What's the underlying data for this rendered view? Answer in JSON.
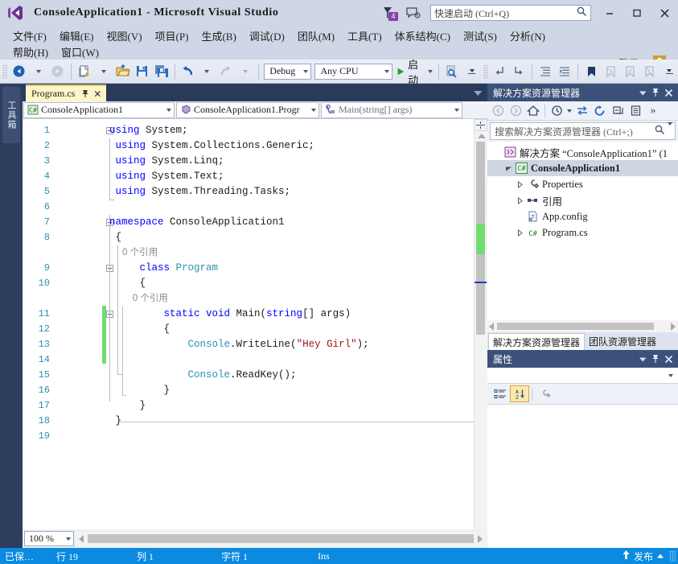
{
  "window": {
    "title": "ConsoleApplication1 - Microsoft Visual Studio",
    "logo_icon": "visual-studio-logo",
    "notifications": {
      "icon": "notification-flag-icon",
      "count": "4"
    },
    "feedback_icon": "feedback-icon",
    "quick_launch": {
      "placeholder": "快速启动 (Ctrl+Q)",
      "value": "",
      "icon": "search-icon"
    },
    "controls": {
      "minimize": "minimize-icon",
      "maximize": "maximize-icon",
      "close": "close-icon"
    }
  },
  "menu": {
    "row1": [
      "文件(F)",
      "编辑(E)",
      "视图(V)",
      "项目(P)",
      "生成(B)",
      "调试(D)",
      "团队(M)",
      "工具(T)",
      "体系结构(C)",
      "测试(S)",
      "分析(N)"
    ],
    "row2": [
      "窗口(W)",
      "帮助(H)"
    ],
    "signin": "登录",
    "signin_icon": "account-icon"
  },
  "toolbar": {
    "nav_back": "navigate-back-icon",
    "nav_forward": "navigate-forward-icon",
    "new_project": "new-project-icon",
    "open_file": "open-file-icon",
    "save": "save-icon",
    "save_all": "save-all-icon",
    "undo": "undo-icon",
    "redo": "redo-icon",
    "configuration": "Debug",
    "platform": "Any CPU",
    "start_label": "启动",
    "start_icon": "play-icon",
    "find_icon": "find-in-files-icon",
    "step_into_icon": "step-into-icon",
    "step_over_icon": "step-over-icon",
    "indent_icon": "increase-indent-icon",
    "comment_icon": "comment-icon",
    "bookmark_icon": "bookmark-icon",
    "prev_bookmark_icon": "previous-bookmark-icon",
    "next_bookmark_icon": "next-bookmark-icon",
    "clear_bookmark_icon": "clear-bookmarks-icon",
    "overflow_icon": "toolbar-overflow-icon"
  },
  "toolbox": {
    "label": "工具箱"
  },
  "editor": {
    "tab": {
      "name": "Program.cs",
      "pin_icon": "pin-icon",
      "close_icon": "close-icon"
    },
    "tabstrip_menu_icon": "active-files-dropdown-icon",
    "nav": {
      "project": "ConsoleApplication1",
      "project_icon": "csharp-project-icon",
      "type": "ConsoleApplication1.Progr",
      "type_icon": "class-icon",
      "member": "Main(string[] args)",
      "member_icon": "method-private-icon"
    },
    "zoom": "100 %",
    "lines": [
      {
        "n": "1",
        "fold": "minus",
        "tokens": [
          {
            "t": "using ",
            "c": "kw"
          },
          {
            "t": "System;",
            "c": ""
          }
        ]
      },
      {
        "n": "2",
        "fold": "",
        "tokens": [
          {
            "t": " using ",
            "c": "kw"
          },
          {
            "t": "System.Collections.Generic;",
            "c": ""
          }
        ]
      },
      {
        "n": "3",
        "fold": "",
        "tokens": [
          {
            "t": " using ",
            "c": "kw"
          },
          {
            "t": "System.Linq;",
            "c": ""
          }
        ]
      },
      {
        "n": "4",
        "fold": "",
        "tokens": [
          {
            "t": " using ",
            "c": "kw"
          },
          {
            "t": "System.Text;",
            "c": ""
          }
        ]
      },
      {
        "n": "5",
        "fold": "",
        "tokens": [
          {
            "t": " using ",
            "c": "kw"
          },
          {
            "t": "System.Threading.Tasks;",
            "c": ""
          }
        ]
      },
      {
        "n": "6",
        "fold": "",
        "tokens": []
      },
      {
        "n": "7",
        "fold": "minus",
        "tokens": [
          {
            "t": "namespace ",
            "c": "kw"
          },
          {
            "t": "ConsoleApplication1",
            "c": ""
          }
        ]
      },
      {
        "n": "8",
        "fold": "",
        "tokens": [
          {
            "t": " {",
            "c": ""
          }
        ]
      },
      {
        "n": "",
        "fold": "",
        "tokens": [
          {
            "t": "     0 个引用",
            "c": "ref"
          }
        ]
      },
      {
        "n": "9",
        "fold": "minus",
        "tokens": [
          {
            "t": "     class ",
            "c": "kw"
          },
          {
            "t": "Program",
            "c": "typ"
          }
        ]
      },
      {
        "n": "10",
        "fold": "",
        "tokens": [
          {
            "t": "     {",
            "c": ""
          }
        ]
      },
      {
        "n": "",
        "fold": "",
        "tokens": [
          {
            "t": "         0 个引用",
            "c": "ref"
          }
        ]
      },
      {
        "n": "11",
        "fold": "minus",
        "tokens": [
          {
            "t": "         static void ",
            "c": "kw"
          },
          {
            "t": "Main(",
            "c": ""
          },
          {
            "t": "string",
            "c": "kw"
          },
          {
            "t": "[] args)",
            "c": ""
          }
        ]
      },
      {
        "n": "12",
        "fold": "",
        "tokens": [
          {
            "t": "         {",
            "c": ""
          }
        ]
      },
      {
        "n": "13",
        "fold": "",
        "tokens": [
          {
            "t": "             ",
            "c": ""
          },
          {
            "t": "Console",
            "c": "typ"
          },
          {
            "t": ".WriteLine(",
            "c": ""
          },
          {
            "t": "\"Hey Girl\"",
            "c": "str"
          },
          {
            "t": ");",
            "c": ""
          }
        ]
      },
      {
        "n": "14",
        "fold": "",
        "tokens": []
      },
      {
        "n": "15",
        "fold": "",
        "tokens": [
          {
            "t": "             ",
            "c": ""
          },
          {
            "t": "Console",
            "c": "typ"
          },
          {
            "t": ".ReadKey();",
            "c": ""
          }
        ]
      },
      {
        "n": "16",
        "fold": "",
        "tokens": [
          {
            "t": "         }",
            "c": ""
          }
        ]
      },
      {
        "n": "17",
        "fold": "",
        "tokens": [
          {
            "t": "     }",
            "c": ""
          }
        ]
      },
      {
        "n": "18",
        "fold": "",
        "tokens": [
          {
            "t": " }",
            "c": ""
          }
        ]
      },
      {
        "n": "19",
        "fold": "",
        "tokens": []
      }
    ]
  },
  "solution_explorer": {
    "title": "解决方案资源管理器",
    "header_icons": {
      "dropdown": "chevron-down-icon",
      "pin": "pin-icon",
      "close": "close-icon"
    },
    "toolbar_icons": [
      "back-icon",
      "forward-icon",
      "home-icon",
      "pending-changes-icon",
      "sync-with-active-document-icon",
      "refresh-icon",
      "collapse-all-icon",
      "properties-window-icon",
      "overflow-icon"
    ],
    "search_placeholder": "搜索解决方案资源管理器 (Ctrl+;)",
    "search_icon": "search-icon",
    "tree": [
      {
        "indent": 0,
        "expander": "none",
        "icon": "solution-icon",
        "label": "解决方案 “ConsoleApplication1” (1",
        "bold": false,
        "selected": false
      },
      {
        "indent": 1,
        "expander": "expanded",
        "icon": "csharp-project-icon",
        "label": "ConsoleApplication1",
        "bold": true,
        "selected": true
      },
      {
        "indent": 2,
        "expander": "collapsed",
        "icon": "properties-icon",
        "label": "Properties",
        "bold": false,
        "selected": false
      },
      {
        "indent": 2,
        "expander": "collapsed",
        "icon": "references-icon",
        "label": "引用",
        "bold": false,
        "selected": false
      },
      {
        "indent": 2,
        "expander": "none",
        "icon": "config-file-icon",
        "label": "App.config",
        "bold": false,
        "selected": false
      },
      {
        "indent": 2,
        "expander": "collapsed",
        "icon": "csharp-file-icon",
        "label": "Program.cs",
        "bold": false,
        "selected": false
      }
    ]
  },
  "panel_tabs": [
    {
      "label": "解决方案资源管理器",
      "active": true
    },
    {
      "label": "团队资源管理器",
      "active": false
    }
  ],
  "properties_panel": {
    "title": "属性",
    "header_icons": {
      "dropdown": "chevron-down-icon",
      "pin": "pin-icon",
      "close": "close-icon"
    },
    "object_selector": "",
    "object_selector_icon": "chevron-down-icon",
    "toolbar": [
      {
        "icon": "categorized-icon",
        "active": false
      },
      {
        "icon": "alphabetical-sort-icon",
        "active": true
      },
      {
        "icon": "property-pages-icon",
        "active": false
      }
    ]
  },
  "statusbar": {
    "saved": "已保…",
    "row": "行 19",
    "col": "列 1",
    "char": "字符 1",
    "insert_mode": "Ins",
    "publish": "发布",
    "publish_icon": "publish-up-arrow-icon",
    "publish_caret": "chevron-up-icon"
  }
}
